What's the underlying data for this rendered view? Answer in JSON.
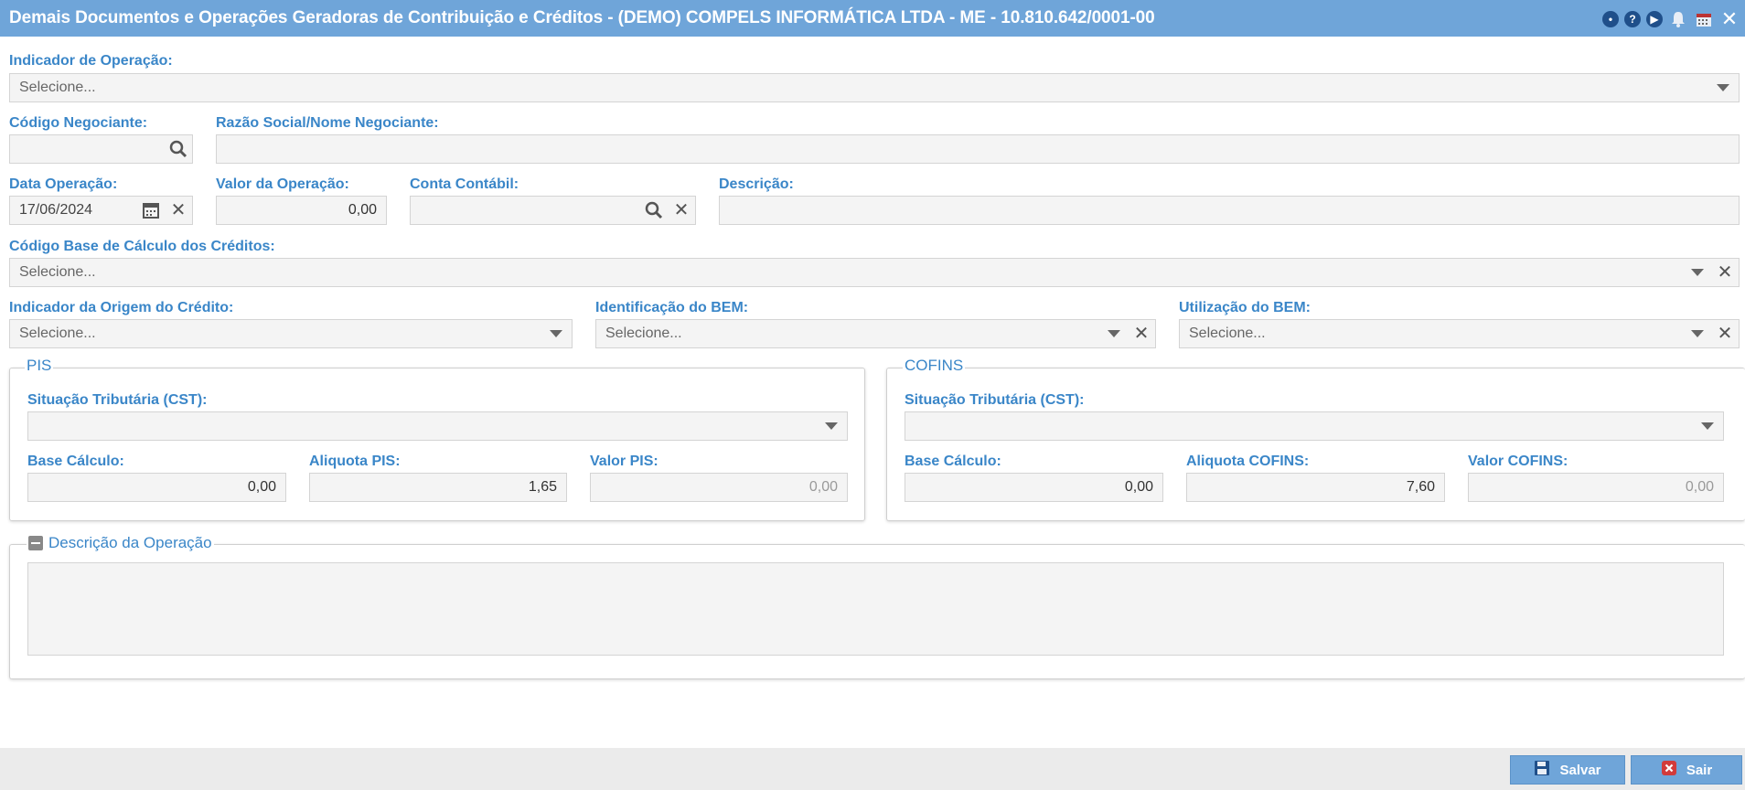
{
  "window": {
    "title": "Demais Documentos e Operações Geradoras de Contribuição e Créditos - (DEMO) COMPELS INFORMÁTICA LTDA - ME - 10.810.642/0001-00",
    "icons": [
      "chat-icon",
      "help-icon",
      "play-icon",
      "bell-icon",
      "calendar-icon",
      "close-icon"
    ]
  },
  "form": {
    "indicador_operacao": {
      "label": "Indicador de Operação:",
      "value": "Selecione..."
    },
    "codigo_negociante": {
      "label": "Código Negociante:",
      "value": ""
    },
    "razao_social": {
      "label": "Razão Social/Nome Negociante:",
      "value": ""
    },
    "data_operacao": {
      "label": "Data Operação:",
      "value": "17/06/2024"
    },
    "valor_operacao": {
      "label": "Valor da Operação:",
      "value": "0,00"
    },
    "conta_contabil": {
      "label": "Conta Contábil:",
      "value": ""
    },
    "descricao": {
      "label": "Descrição:",
      "value": ""
    },
    "codigo_base": {
      "label": "Código Base de Cálculo dos Créditos:",
      "value": "Selecione..."
    },
    "indicador_origem": {
      "label": "Indicador da Origem do Crédito:",
      "value": "Selecione..."
    },
    "identificacao_bem": {
      "label": "Identificação do BEM:",
      "value": "Selecione..."
    },
    "utilizacao_bem": {
      "label": "Utilização do BEM:",
      "value": "Selecione..."
    }
  },
  "pis": {
    "legend": "PIS",
    "cst_label": "Situação Tributária (CST):",
    "cst_value": "",
    "base_label": "Base Cálculo:",
    "base_value": "0,00",
    "aliquota_label": "Aliquota PIS:",
    "aliquota_value": "1,65",
    "valor_label": "Valor PIS:",
    "valor_value": "0,00"
  },
  "cofins": {
    "legend": "COFINS",
    "cst_label": "Situação Tributária (CST):",
    "cst_value": "",
    "base_label": "Base Cálculo:",
    "base_value": "0,00",
    "aliquota_label": "Aliquota COFINS:",
    "aliquota_value": "7,60",
    "valor_label": "Valor COFINS:",
    "valor_value": "0,00"
  },
  "descricao_operacao": {
    "legend": "Descrição da Operação",
    "value": ""
  },
  "footer": {
    "save_label": "Salvar",
    "exit_label": "Sair"
  },
  "colors": {
    "accent": "#6fa5d9",
    "label": "#3a86c8",
    "field_bg": "#f4f4f4"
  }
}
